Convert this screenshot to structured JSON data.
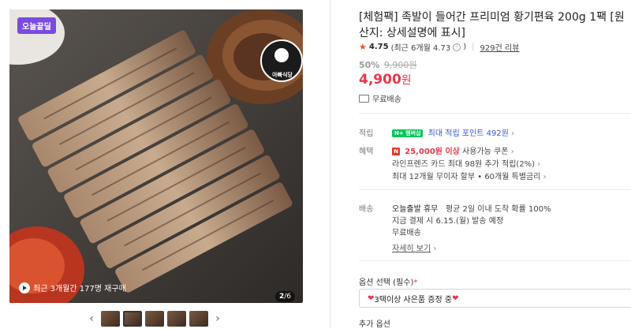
{
  "gallery": {
    "badge": "오늘끝딜",
    "brand_badge": "아빠식당",
    "repurchase_note": "최근 3개월간 177명 재구매",
    "counter_current": "2",
    "counter_total": "6",
    "thumbnail_count": 5,
    "active_thumbnail": 1
  },
  "product": {
    "title": "[체험팩] 족발이 들어간 프리미엄 황기편육 200g 1팩 [원산지: 상세설명에 표시]",
    "rating": "4.75",
    "rating_recent": "(최근 6개월 4.73",
    "rating_recent_close": ")",
    "review_count": "929건 리뷰",
    "discount_rate": "50%",
    "original_price": "9,900원",
    "price": "4,900",
    "price_unit": "원",
    "shipping": "무료배송"
  },
  "benefits": {
    "points_label": "적립",
    "npay_badge": "N+ 멤버십",
    "points_text": "최대 적립 포인트 492원",
    "benefit_label": "혜택",
    "coupon_amount": "25,000원 이상",
    "coupon_text": "사용가능 쿠폰",
    "card_line": "라인프렌즈 카드 최대 98원 추가 적립(2%)",
    "installment_line": "최대 12개월 무이자 할부 • 60개월 특별금리"
  },
  "delivery": {
    "label": "배송",
    "today_label": "오늘출발 휴무",
    "today_text": "평균 2일 이내 도착 확률 100%",
    "dispatch_text": "지금 결제 시 6.15.(월) 발송 예정",
    "fee": "무료배송",
    "detail_link": "자세히 보기"
  },
  "options": {
    "label": "옵션 선택",
    "required": "(필수)",
    "required_mark": "*",
    "selected": "3택이상 사은품 증정 중",
    "additional_label": "추가 옵션"
  },
  "colors": {
    "price_red": "#e8364a",
    "badge_purple": "#7b4be0",
    "npay_green": "#03c75a",
    "link_blue": "#3b56d6"
  }
}
